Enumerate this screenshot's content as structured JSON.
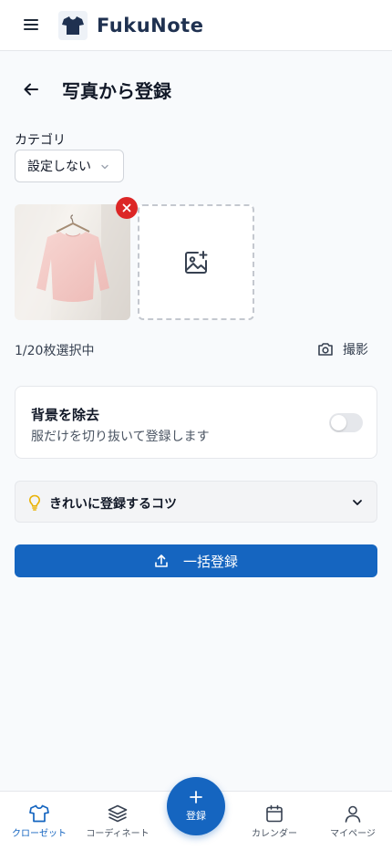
{
  "app": {
    "brand_name": "FukuNote",
    "logo_icon": "tshirt-icon"
  },
  "header": {
    "title": "写真から登録",
    "back_icon": "arrow-left-icon"
  },
  "category": {
    "label": "カテゴリ",
    "selected": "設定しない"
  },
  "photos": {
    "count_text": "1/20枚選択中",
    "shoot_label": "撮影"
  },
  "background_removal": {
    "title": "背景を除去",
    "description": "服だけを切り抜いて登録します",
    "enabled": false
  },
  "tips": {
    "label": "きれいに登録するコツ"
  },
  "register_button": {
    "label": "一括登録"
  },
  "bottom_nav": {
    "items": [
      {
        "label": "クローゼット",
        "icon": "shirt-icon",
        "active": true
      },
      {
        "label": "コーディネート",
        "icon": "layers-icon",
        "active": false
      },
      {
        "label": "カレンダー",
        "icon": "calendar-icon",
        "active": false
      },
      {
        "label": "マイページ",
        "icon": "user-icon",
        "active": false
      }
    ],
    "fab_label": "登録"
  },
  "colors": {
    "primary": "#1565c0",
    "danger": "#dc2626",
    "brand_text": "#1f3150"
  }
}
